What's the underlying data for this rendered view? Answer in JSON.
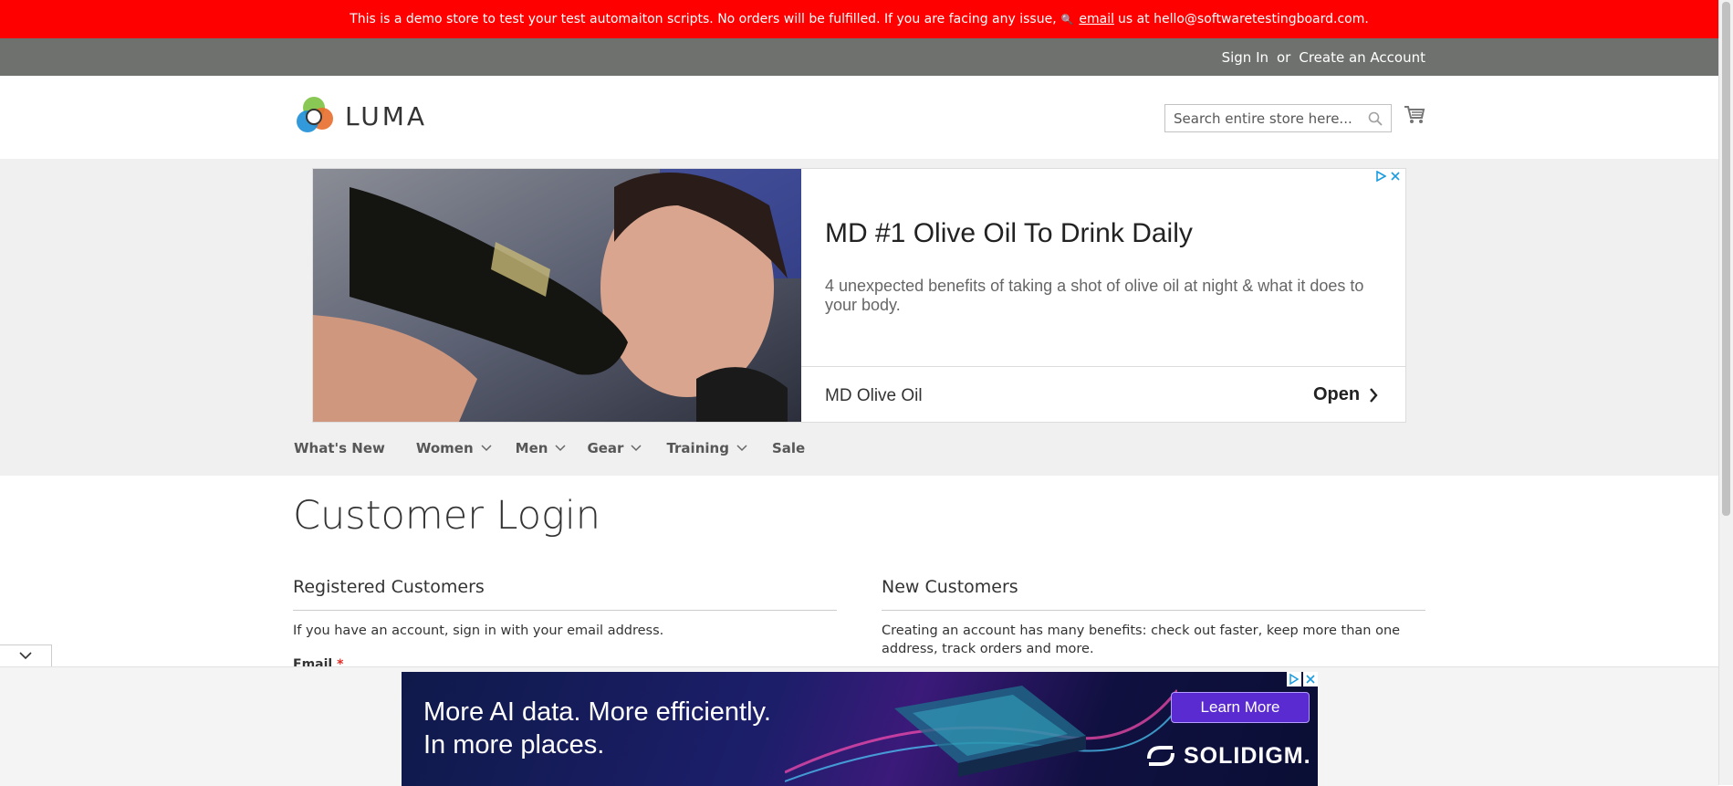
{
  "demo_banner": {
    "text_before": "This is a demo store to test your test automaiton scripts. No orders will be fulfilled. If you are facing any issue,",
    "email_link": "email",
    "text_after": "us at hello@softwaretestingboard.com."
  },
  "header_links": {
    "sign_in": "Sign In",
    "or": "or",
    "create_account": "Create an Account"
  },
  "logo": {
    "text": "LUMA"
  },
  "search": {
    "placeholder": "Search entire store here..."
  },
  "ad": {
    "title": "MD #1 Olive Oil To Drink Daily",
    "description": "4 unexpected benefits of taking a shot of olive oil at night & what it does to your body.",
    "advertiser": "MD Olive Oil",
    "cta": "Open"
  },
  "nav": {
    "items": [
      {
        "label": "What's New",
        "has_dropdown": false
      },
      {
        "label": "Women",
        "has_dropdown": true
      },
      {
        "label": "Men",
        "has_dropdown": true
      },
      {
        "label": "Gear",
        "has_dropdown": true
      },
      {
        "label": "Training",
        "has_dropdown": true
      },
      {
        "label": "Sale",
        "has_dropdown": false
      }
    ]
  },
  "page": {
    "title": "Customer Login",
    "registered": {
      "heading": "Registered Customers",
      "text": "If you have an account, sign in with your email address.",
      "email_label": "Email",
      "required_mark": "*"
    },
    "new_customers": {
      "heading": "New Customers",
      "text": "Creating an account has many benefits: check out faster, keep more than one address, track orders and more."
    }
  },
  "bottom_ad": {
    "headline_line1": "More AI data. More efficiently.",
    "headline_line2": "In more places.",
    "cta": "Learn More",
    "brand": "SOLIDIGM."
  },
  "colors": {
    "banner_red": "#ff0000",
    "panel_gray": "#6e716e",
    "nav_bg": "#f0f0f0"
  }
}
